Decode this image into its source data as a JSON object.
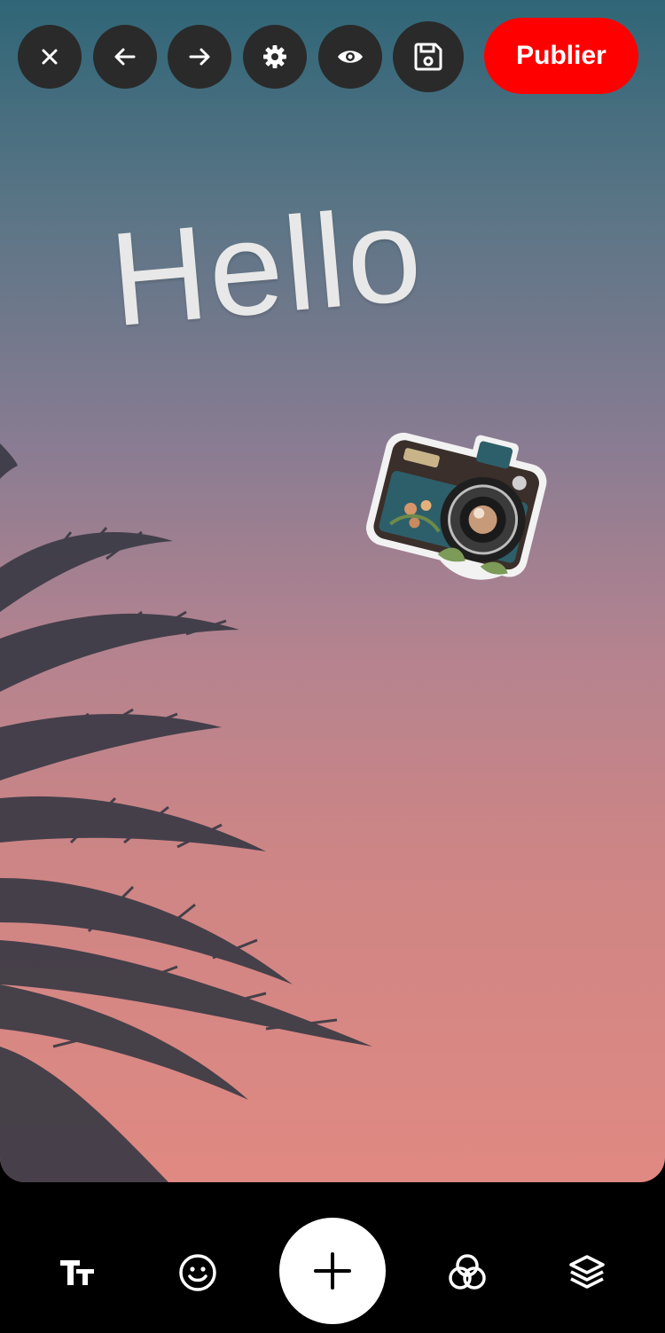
{
  "toolbar": {
    "publish_label": "Publier",
    "icons": [
      "close-icon",
      "undo-arrow-icon",
      "redo-arrow-icon",
      "settings-gear-icon",
      "preview-eye-icon",
      "save-floppy-icon"
    ]
  },
  "canvas": {
    "text_overlay": "Hello",
    "sticker": "vintage-camera-sticker"
  },
  "bottom_bar": {
    "icons": [
      "text-icon",
      "emoji-icon",
      "add-plus-icon",
      "filters-icon",
      "layers-icon"
    ]
  },
  "colors": {
    "publish": "#ff0000",
    "toolbar_button": "#2a2a2a",
    "gradient_top": "#2f6677",
    "gradient_bottom": "#e08982"
  }
}
